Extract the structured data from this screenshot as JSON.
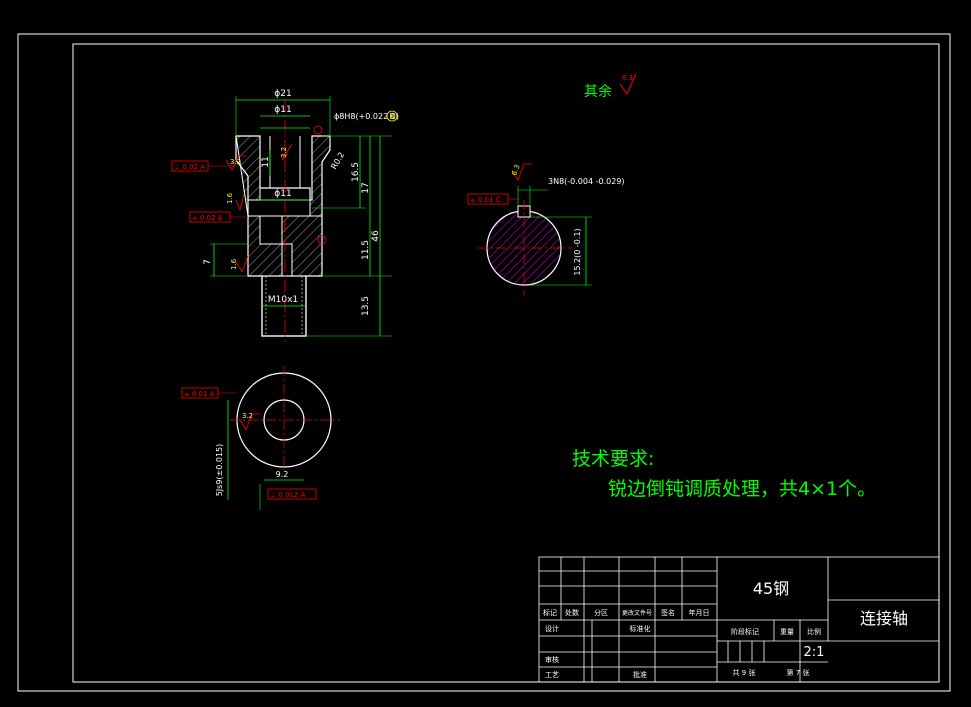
{
  "remaining_roughness": {
    "label": "其余",
    "value": "6.3"
  },
  "tech_requirements": {
    "title": "技术要求:",
    "line1": "锐边倒钝调质处理，共4×1个。"
  },
  "title_block": {
    "material": "45钢",
    "part_name": "连接轴",
    "scale": "2:1",
    "labels": {
      "biaoji": "标记",
      "chushu": "处数",
      "fenqu": "分区",
      "gaiwenjian": "更改文件号",
      "qianming": "签名",
      "nianyueri": "年月日",
      "sheji": "设计",
      "biaozhunhua": "标准化",
      "jieduan": "阶段标记",
      "zhongliang": "重量",
      "bili": "比例",
      "shenhe": "审核",
      "gongyi": "工艺",
      "pizhun": "批准",
      "gong": "共 9 张",
      "di": "第 7 张"
    }
  },
  "dims": {
    "d21": "ϕ21",
    "d11_top": "ϕ11",
    "d8h8": "ϕ8H8(+0.022 0)",
    "d11_mid": "ϕ11",
    "m10": "M10x1",
    "h16_5": "16.5",
    "h17": "17",
    "h46": "46",
    "h11_5": "11.5",
    "h13_5": "13.5",
    "h11": "11",
    "h7": "7",
    "r0_2": "R0.2",
    "keyway": "3N8(-0.004 -0.029)",
    "key_depth": "15.2(0 -0.1)",
    "key_width_side": "5Js9(±0.015)",
    "d9_2": "9.2"
  },
  "roughness": {
    "r3_2a": "3.2",
    "r3_2b": "3.2",
    "r1_6a": "1.6",
    "r1_6b": "1.6",
    "r6_3": "6.3",
    "r3_2c": "3.2"
  },
  "tolerances": {
    "perp": "⊥ 0.02 A",
    "sym_a": "⌯ 0.02 A",
    "par_a": "∥ 0.02 A",
    "sym_c": "⌯ 0.01 C",
    "circ_a": "⌯ 0.01 A",
    "sym_b": "⊥ 0.012 A",
    "datum_b": "B",
    "datum_a": "A",
    "datum_c": "C"
  },
  "colors": {
    "border": "#ffffff",
    "green": "#00ff00",
    "red": "#ff0000",
    "magenta": "#ff00ff",
    "yellow": "#ffff00"
  }
}
